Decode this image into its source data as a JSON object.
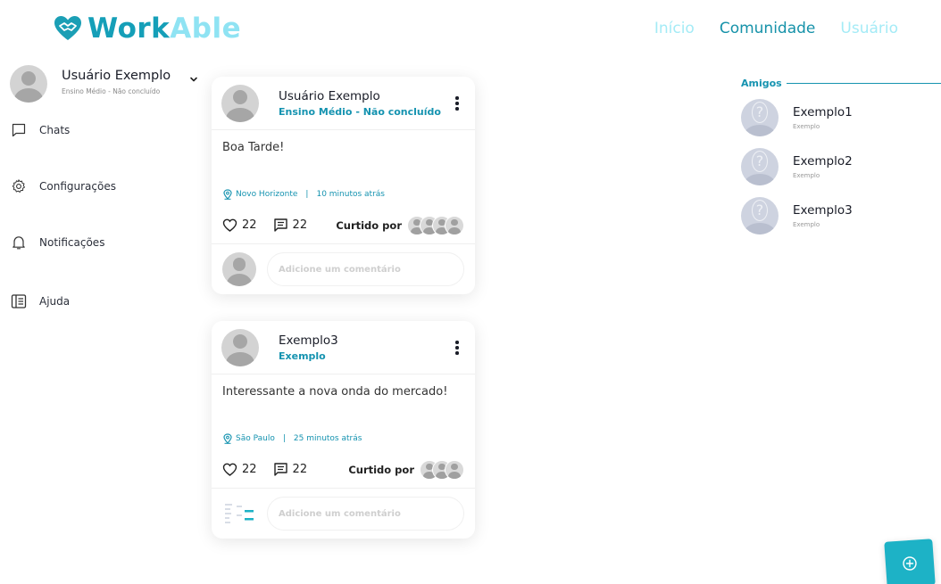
{
  "brand": {
    "part1": "Work",
    "part2": "Able",
    "color_primary": "#159fb8",
    "color_secondary": "#8fe3f3"
  },
  "nav": {
    "items": [
      {
        "label": "Início",
        "state": "muted"
      },
      {
        "label": "Comunidade",
        "state": "active"
      },
      {
        "label": "Usuário",
        "state": "muted"
      }
    ]
  },
  "sidebar": {
    "user": {
      "name": "Usuário Exemplo",
      "subtitle": "Ensino Médio - Não concluído"
    },
    "items": [
      {
        "label": "Chats",
        "icon": "chat-icon"
      },
      {
        "label": "Configurações",
        "icon": "gear-icon"
      },
      {
        "label": "Notificações",
        "icon": "bell-icon"
      },
      {
        "label": "Ajuda",
        "icon": "help-book-icon"
      }
    ]
  },
  "posts": [
    {
      "author": "Usuário Exemplo",
      "role": "Ensino Médio - Não concluído",
      "text": "Boa Tarde!",
      "location": "Novo Horizonte",
      "time": "10 minutos atrás",
      "likes": "22",
      "comments": "22",
      "liked_by_label": "Curtido por",
      "liked_by_count": 4,
      "comment_placeholder": "Adicione um comentário"
    },
    {
      "author": "Exemplo3",
      "role": "Exemplo",
      "text": "Interessante a nova onda do mercado!",
      "location": "São Paulo",
      "time": "25 minutos atrás",
      "likes": "22",
      "comments": "22",
      "liked_by_label": "Curtido por",
      "liked_by_count": 3,
      "comment_placeholder": "Adicione um comentário"
    }
  ],
  "friends": {
    "title": "Amigos",
    "items": [
      {
        "name": "Exemplo1",
        "subtitle": "Exemplo"
      },
      {
        "name": "Exemplo2",
        "subtitle": "Exemplo"
      },
      {
        "name": "Exemplo3",
        "subtitle": "Exemplo"
      }
    ]
  },
  "fab": {
    "icon": "plus-circle-icon",
    "color": "#1db2c6"
  }
}
